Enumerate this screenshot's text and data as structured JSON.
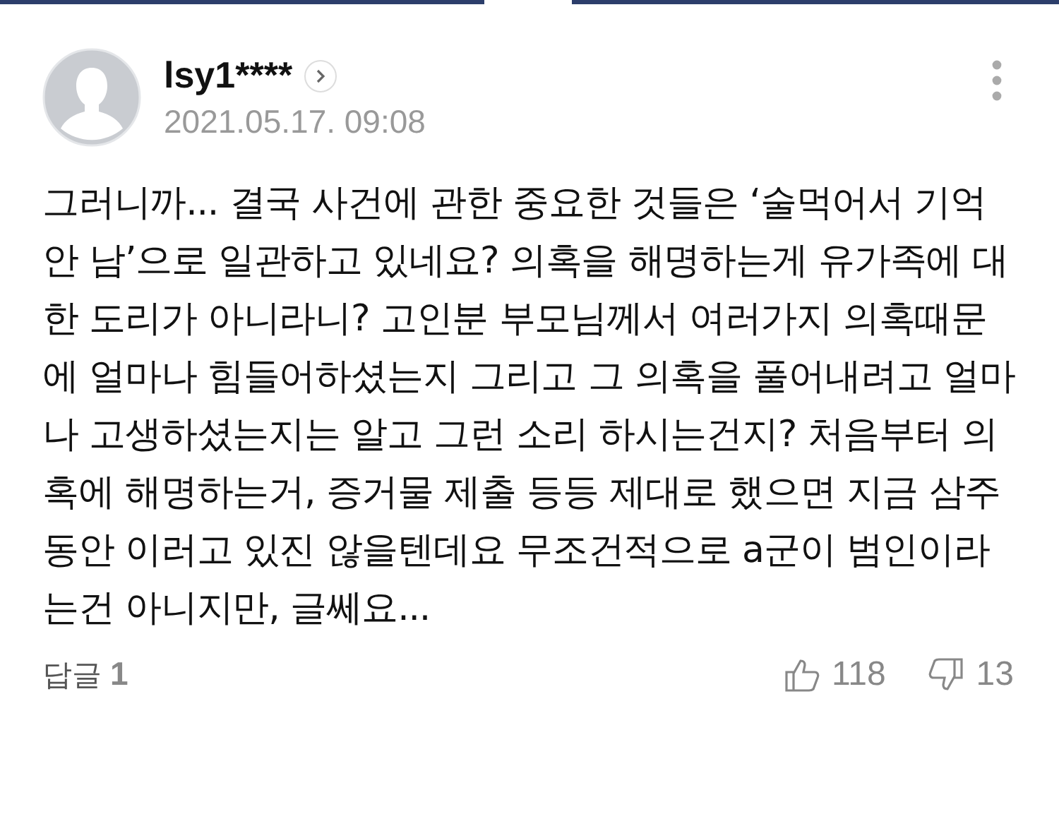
{
  "comment": {
    "author": "lsy1****",
    "date": "2021.05.17. 09:08",
    "body": "그러니까... 결국 사건에 관한 중요한 것들은 ‘술먹어서 기억 안 남’으로 일관하고 있네요? 의혹을 해명하는게 유가족에 대한 도리가 아니라니? 고인분 부모님께서 여러가지 의혹때문에 얼마나 힘들어하셨는지 그리고 그 의혹을 풀어내려고 얼마나 고생하셨는지는 알고 그런 소리 하시는건지? 처음부터 의혹에 해명하는거, 증거물 제출 등등 제대로 했으면 지금 삼주동안 이러고 있진 않을텐데요 무조건적으로 a군이 범인이라는건 아니지만, 글쎄요...",
    "replies_label": "답글",
    "replies_count": "1",
    "likes": "118",
    "dislikes": "13"
  }
}
